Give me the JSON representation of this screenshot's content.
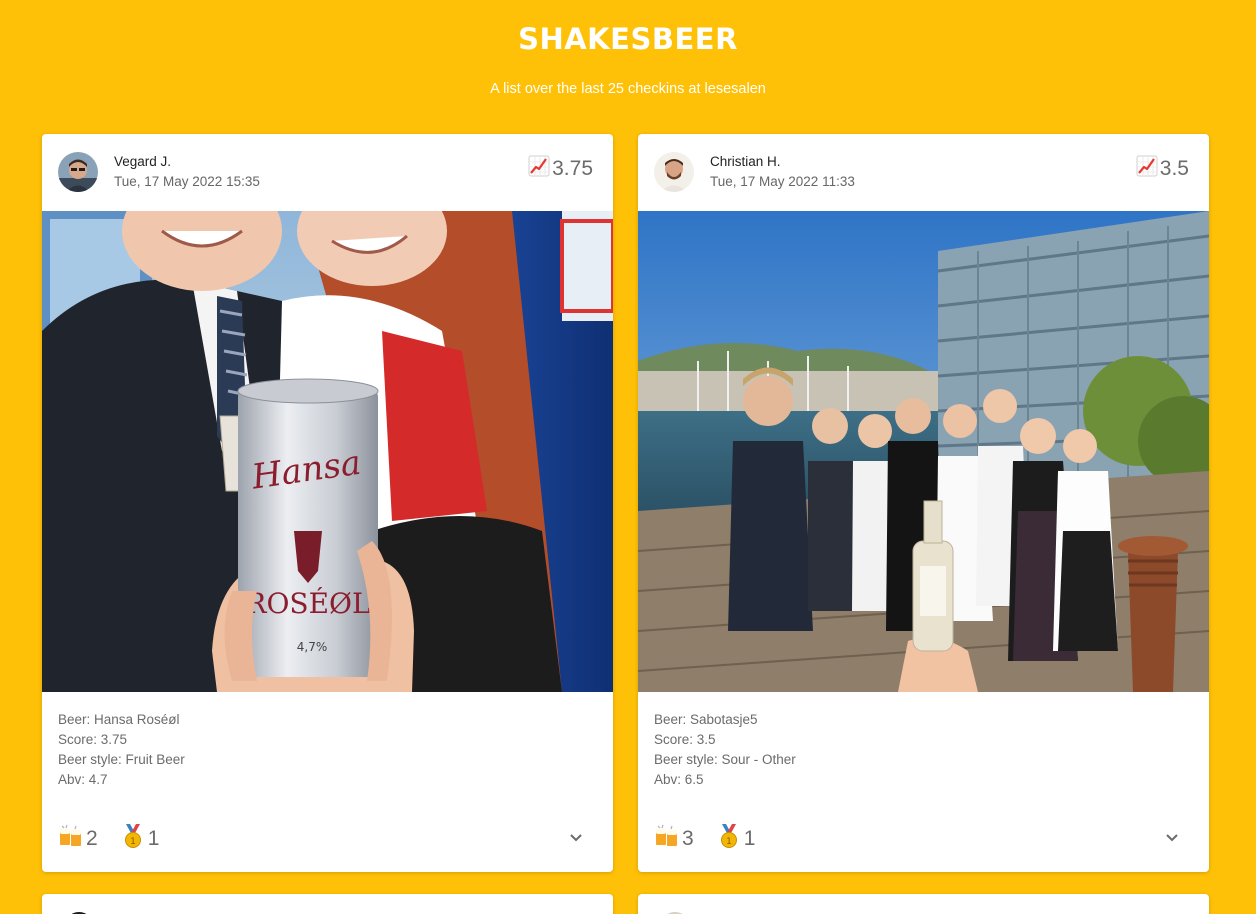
{
  "header": {
    "title": "SHAKESBEER",
    "subtitle": "A list over the last 25 checkins at lesesalen"
  },
  "checkins": [
    {
      "user": "Vegard J.",
      "time": "Tue, 17 May 2022 15:35",
      "rating": "3.75",
      "beer": "Beer: Hansa Roséøl",
      "score": "Score: 3.75",
      "style": "Beer style: Fruit Beer",
      "abv": "Abv: 4.7",
      "toasts": "2",
      "badges": "1",
      "can_brand": "Hansa",
      "can_label": "ROSÉØL",
      "can_abv": "4,7%"
    },
    {
      "user": "Christian H.",
      "time": "Tue, 17 May 2022 11:33",
      "rating": "3.5",
      "beer": "Beer: Sabotasje5",
      "score": "Score: 3.5",
      "style": "Beer style: Sour - Other",
      "abv": "Abv: 6.5",
      "toasts": "3",
      "badges": "1"
    }
  ],
  "icons": {
    "rating": "chart-increasing-icon",
    "toast": "beer-mugs-icon",
    "badge": "medal-icon",
    "expand": "chevron-down-icon"
  },
  "colors": {
    "background": "#ffc107",
    "card": "#ffffff",
    "muted_text": "#6b6b6b"
  }
}
